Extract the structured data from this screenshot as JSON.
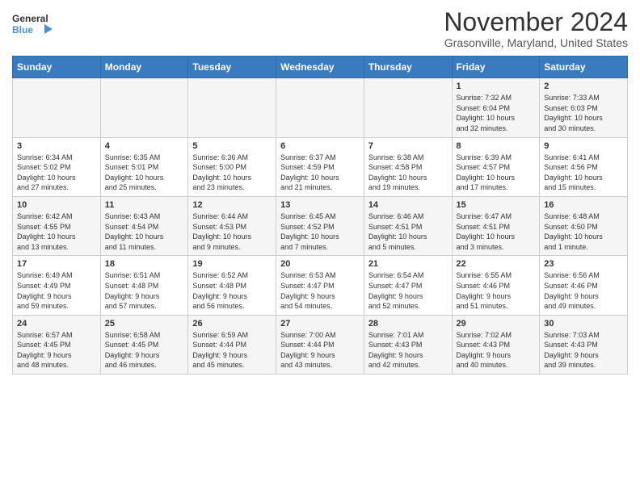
{
  "header": {
    "logo_line1": "General",
    "logo_line2": "Blue",
    "month": "November 2024",
    "location": "Grasonville, Maryland, United States"
  },
  "days_of_week": [
    "Sunday",
    "Monday",
    "Tuesday",
    "Wednesday",
    "Thursday",
    "Friday",
    "Saturday"
  ],
  "weeks": [
    [
      {
        "day": "",
        "info": ""
      },
      {
        "day": "",
        "info": ""
      },
      {
        "day": "",
        "info": ""
      },
      {
        "day": "",
        "info": ""
      },
      {
        "day": "",
        "info": ""
      },
      {
        "day": "1",
        "info": "Sunrise: 7:32 AM\nSunset: 6:04 PM\nDaylight: 10 hours\nand 32 minutes."
      },
      {
        "day": "2",
        "info": "Sunrise: 7:33 AM\nSunset: 6:03 PM\nDaylight: 10 hours\nand 30 minutes."
      }
    ],
    [
      {
        "day": "3",
        "info": "Sunrise: 6:34 AM\nSunset: 5:02 PM\nDaylight: 10 hours\nand 27 minutes."
      },
      {
        "day": "4",
        "info": "Sunrise: 6:35 AM\nSunset: 5:01 PM\nDaylight: 10 hours\nand 25 minutes."
      },
      {
        "day": "5",
        "info": "Sunrise: 6:36 AM\nSunset: 5:00 PM\nDaylight: 10 hours\nand 23 minutes."
      },
      {
        "day": "6",
        "info": "Sunrise: 6:37 AM\nSunset: 4:59 PM\nDaylight: 10 hours\nand 21 minutes."
      },
      {
        "day": "7",
        "info": "Sunrise: 6:38 AM\nSunset: 4:58 PM\nDaylight: 10 hours\nand 19 minutes."
      },
      {
        "day": "8",
        "info": "Sunrise: 6:39 AM\nSunset: 4:57 PM\nDaylight: 10 hours\nand 17 minutes."
      },
      {
        "day": "9",
        "info": "Sunrise: 6:41 AM\nSunset: 4:56 PM\nDaylight: 10 hours\nand 15 minutes."
      }
    ],
    [
      {
        "day": "10",
        "info": "Sunrise: 6:42 AM\nSunset: 4:55 PM\nDaylight: 10 hours\nand 13 minutes."
      },
      {
        "day": "11",
        "info": "Sunrise: 6:43 AM\nSunset: 4:54 PM\nDaylight: 10 hours\nand 11 minutes."
      },
      {
        "day": "12",
        "info": "Sunrise: 6:44 AM\nSunset: 4:53 PM\nDaylight: 10 hours\nand 9 minutes."
      },
      {
        "day": "13",
        "info": "Sunrise: 6:45 AM\nSunset: 4:52 PM\nDaylight: 10 hours\nand 7 minutes."
      },
      {
        "day": "14",
        "info": "Sunrise: 6:46 AM\nSunset: 4:51 PM\nDaylight: 10 hours\nand 5 minutes."
      },
      {
        "day": "15",
        "info": "Sunrise: 6:47 AM\nSunset: 4:51 PM\nDaylight: 10 hours\nand 3 minutes."
      },
      {
        "day": "16",
        "info": "Sunrise: 6:48 AM\nSunset: 4:50 PM\nDaylight: 10 hours\nand 1 minute."
      }
    ],
    [
      {
        "day": "17",
        "info": "Sunrise: 6:49 AM\nSunset: 4:49 PM\nDaylight: 9 hours\nand 59 minutes."
      },
      {
        "day": "18",
        "info": "Sunrise: 6:51 AM\nSunset: 4:48 PM\nDaylight: 9 hours\nand 57 minutes."
      },
      {
        "day": "19",
        "info": "Sunrise: 6:52 AM\nSunset: 4:48 PM\nDaylight: 9 hours\nand 56 minutes."
      },
      {
        "day": "20",
        "info": "Sunrise: 6:53 AM\nSunset: 4:47 PM\nDaylight: 9 hours\nand 54 minutes."
      },
      {
        "day": "21",
        "info": "Sunrise: 6:54 AM\nSunset: 4:47 PM\nDaylight: 9 hours\nand 52 minutes."
      },
      {
        "day": "22",
        "info": "Sunrise: 6:55 AM\nSunset: 4:46 PM\nDaylight: 9 hours\nand 51 minutes."
      },
      {
        "day": "23",
        "info": "Sunrise: 6:56 AM\nSunset: 4:46 PM\nDaylight: 9 hours\nand 49 minutes."
      }
    ],
    [
      {
        "day": "24",
        "info": "Sunrise: 6:57 AM\nSunset: 4:45 PM\nDaylight: 9 hours\nand 48 minutes."
      },
      {
        "day": "25",
        "info": "Sunrise: 6:58 AM\nSunset: 4:45 PM\nDaylight: 9 hours\nand 46 minutes."
      },
      {
        "day": "26",
        "info": "Sunrise: 6:59 AM\nSunset: 4:44 PM\nDaylight: 9 hours\nand 45 minutes."
      },
      {
        "day": "27",
        "info": "Sunrise: 7:00 AM\nSunset: 4:44 PM\nDaylight: 9 hours\nand 43 minutes."
      },
      {
        "day": "28",
        "info": "Sunrise: 7:01 AM\nSunset: 4:43 PM\nDaylight: 9 hours\nand 42 minutes."
      },
      {
        "day": "29",
        "info": "Sunrise: 7:02 AM\nSunset: 4:43 PM\nDaylight: 9 hours\nand 40 minutes."
      },
      {
        "day": "30",
        "info": "Sunrise: 7:03 AM\nSunset: 4:43 PM\nDaylight: 9 hours\nand 39 minutes."
      }
    ]
  ]
}
